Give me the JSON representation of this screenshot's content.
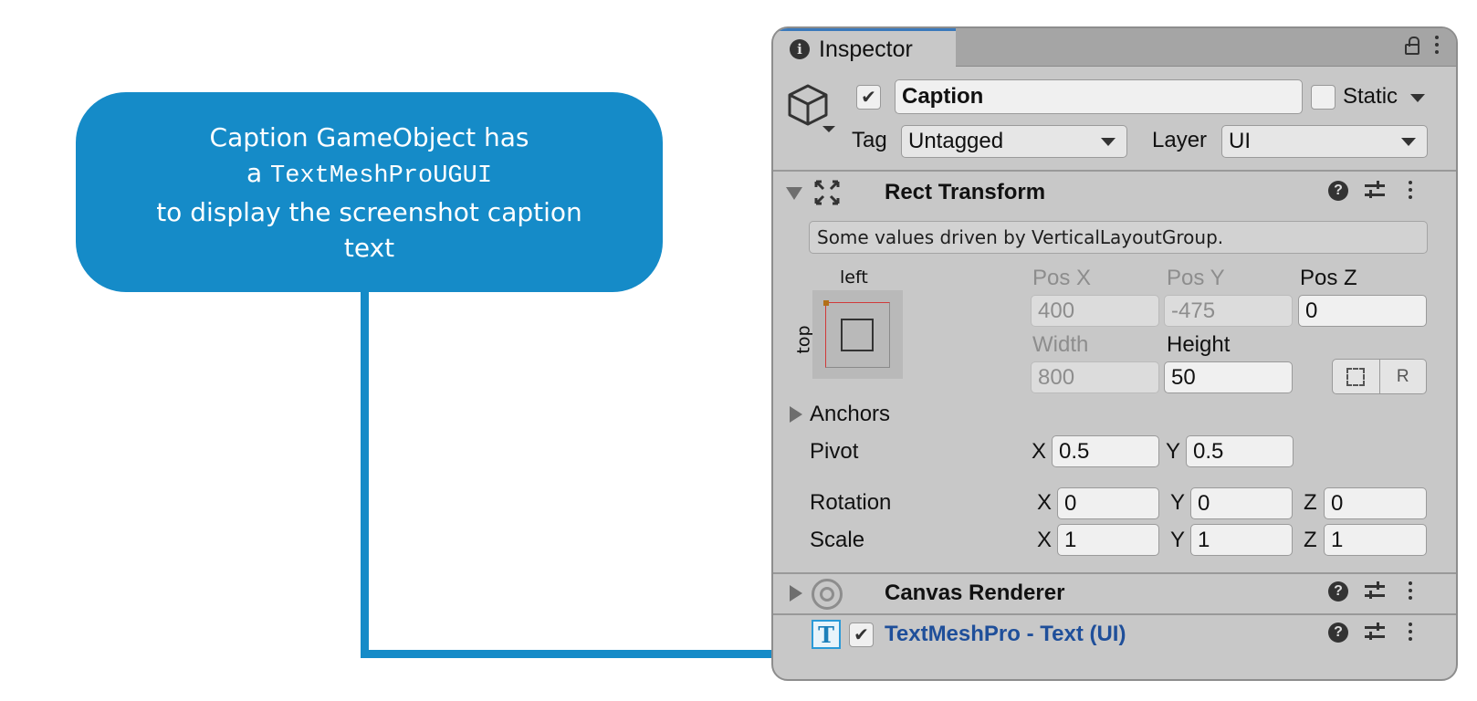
{
  "callout": {
    "line1": "Caption GameObject has",
    "line2_prefix": "a ",
    "line2_code": "TextMeshProUGUI",
    "line3": "to display the screenshot caption",
    "line4": "text"
  },
  "inspector": {
    "tab_label": "Inspector",
    "object_name": "Caption",
    "active_checked": true,
    "static_label": "Static",
    "static_checked": false,
    "tag_label": "Tag",
    "tag_value": "Untagged",
    "layer_label": "Layer",
    "layer_value": "UI"
  },
  "rect_transform": {
    "title": "Rect Transform",
    "help_text": "Some values driven by VerticalLayoutGroup.",
    "anchor_h": "left",
    "anchor_v": "top",
    "pos_x_label": "Pos X",
    "pos_y_label": "Pos Y",
    "pos_z_label": "Pos Z",
    "pos_x": "400",
    "pos_y": "-475",
    "pos_z": "0",
    "width_label": "Width",
    "height_label": "Height",
    "width": "800",
    "height": "50",
    "r_button": "R",
    "anchors_label": "Anchors",
    "pivot_label": "Pivot",
    "pivot_x": "0.5",
    "pivot_y": "0.5",
    "rotation_label": "Rotation",
    "rotation_x": "0",
    "rotation_y": "0",
    "rotation_z": "0",
    "scale_label": "Scale",
    "scale_x": "1",
    "scale_y": "1",
    "scale_z": "1",
    "axis_x": "X",
    "axis_y": "Y",
    "axis_z": "Z"
  },
  "components": {
    "canvas_renderer": "Canvas Renderer",
    "textmeshpro": "TextMeshPro - Text (UI)",
    "textmeshpro_enabled": true,
    "textmeshpro_icon_letter": "T"
  },
  "icons": {
    "help": "?",
    "checkmark": "✔",
    "info": "i"
  },
  "colors": {
    "callout_blue": "#158bc8",
    "inspector_bg": "#c8c8c8",
    "tab_accent": "#3a79bb",
    "tmp_title": "#1f4f9a"
  }
}
